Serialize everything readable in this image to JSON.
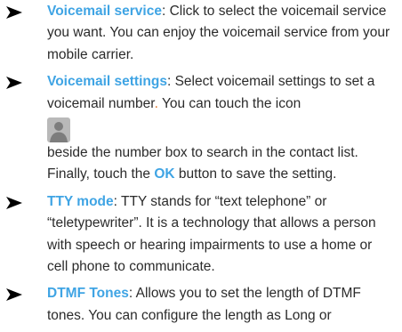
{
  "items": [
    {
      "icon": "arrowhead-bullet-icon",
      "term": "Voicemail service",
      "text": ": Click to select the voicemail service you want. You can enjoy the voicemail service from your mobile carrier."
    },
    {
      "icon": "arrowhead-bullet-icon",
      "term": "Voicemail settings",
      "text_a": ": Select voicemail settings to set a voicemail number",
      "text_dot": ".",
      "text_b": " You can touch the icon",
      "inline_icon": "contact-person-icon",
      "text_c": "beside the number box to search in the contact list. Finally, touch the ",
      "button_name": "OK",
      "text_d": " button to save the setting."
    },
    {
      "icon": "arrowhead-bullet-icon",
      "term": "TTY mode",
      "text": ": TTY stands for “text telephone” or “teletypewriter”. It is a technology that allows a person with speech or hearing impairments to use a home or cell phone to communicate."
    },
    {
      "icon": "arrowhead-bullet-icon",
      "term": "DTMF Tones",
      "text": ": Allows you to set the length of DTMF tones. You can configure the length as Long or"
    }
  ],
  "colors": {
    "accent": "#3fa4e4",
    "body_text": "#2b2b2b",
    "punctuation_accent": "#e07020",
    "icon_fill": "#b9b9b9"
  }
}
